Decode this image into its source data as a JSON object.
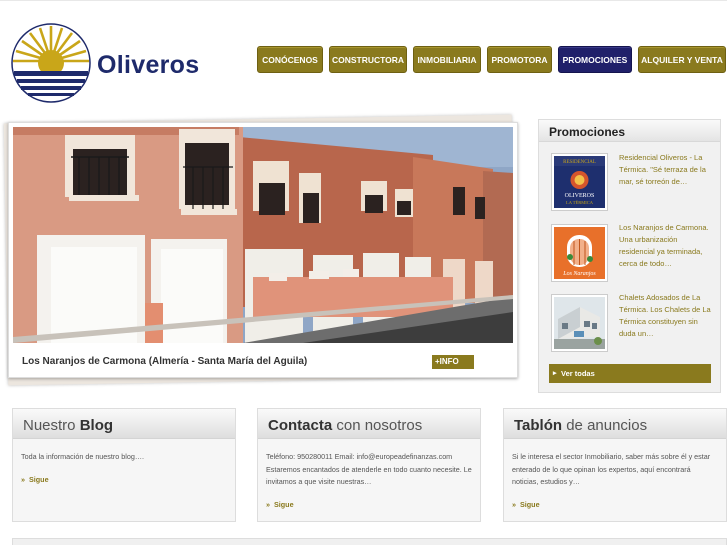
{
  "brand": {
    "name": "Oliveros"
  },
  "nav": [
    {
      "label": "CONÓCENOS",
      "active": false
    },
    {
      "label": "CONSTRUCTORA",
      "active": false
    },
    {
      "label": "INMOBILIARIA",
      "active": false
    },
    {
      "label": "PROMOTORA",
      "active": false
    },
    {
      "label": "PROMOCIONES",
      "active": true
    },
    {
      "label": "ALQUILER Y VENTA",
      "active": false
    }
  ],
  "slider": {
    "caption": "Los Naranjos de Carmona (Almería - Santa María del Aguila)",
    "info_label": "+INFO"
  },
  "promociones": {
    "title": "Promociones",
    "items": [
      {
        "text": "Residencial Oliveros - La Térmica. \"Sé terraza de la mar, sé torreón de…",
        "img_top": "RESIDENCIAL",
        "img_mid": "OLIVEROS",
        "img_bot": "LA TÉRMICA"
      },
      {
        "text": "Los Naranjos de Carmona. Una urbanización residencial ya terminada, cerca de todo…",
        "img_label": "Los Naranjos"
      },
      {
        "text": "Chalets Adosados de La Térmica. Los Chalets de La Térmica constituyen sin duda un…"
      }
    ],
    "ver_todas": "Ver todas"
  },
  "boxes": [
    {
      "title_a": "Nuestro ",
      "title_b": "Blog",
      "title_c": "",
      "text": "Toda la información de nuestro blog….",
      "more": "Sigue"
    },
    {
      "title_a": "",
      "title_b": "Contacta",
      "title_c": " con nosotros",
      "text": "Teléfono: 950280011 Email: info@europeadefinanzas.com Estaremos encantados de atenderle en todo cuanto necesite. Le invitamos a que visite nuestras…",
      "more": "Sigue"
    },
    {
      "title_a": "",
      "title_b": "Tablón",
      "title_c": " de anuncios",
      "text": "Si le interesa el sector Inmobiliario, saber más sobre él y estar enterado de lo que opinan los expertos, aquí encontrará noticias, estudios y…",
      "more": "Sigue"
    }
  ],
  "colors": {
    "accent": "#8a7a1e",
    "active": "#20206a",
    "brand": "#1e2a6b"
  }
}
